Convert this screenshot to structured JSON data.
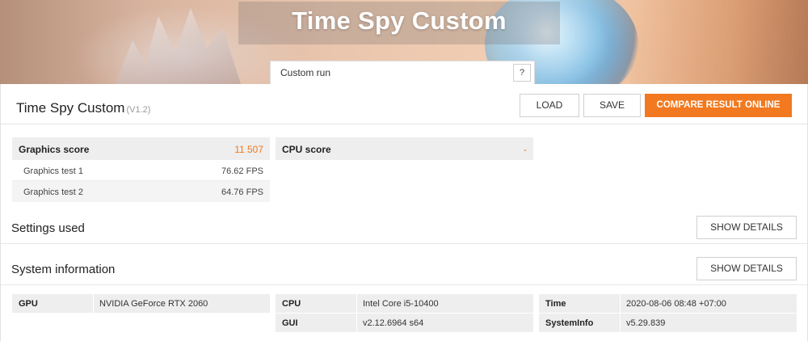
{
  "hero": {
    "title": "Time Spy Custom",
    "run_selector": {
      "value": "Custom run",
      "help_label": "?"
    }
  },
  "header": {
    "title": "Time Spy Custom",
    "version": "(V1.2)",
    "load_label": "LOAD",
    "save_label": "SAVE",
    "compare_label": "COMPARE RESULT ONLINE"
  },
  "graphics": {
    "label": "Graphics score",
    "value": "11 507",
    "tests": [
      {
        "name": "Graphics test 1",
        "value": "76.62 FPS"
      },
      {
        "name": "Graphics test 2",
        "value": "64.76 FPS"
      }
    ]
  },
  "cpu_score": {
    "label": "CPU score",
    "value": "-"
  },
  "settings": {
    "title": "Settings used",
    "details_label": "SHOW DETAILS"
  },
  "system": {
    "title": "System information",
    "details_label": "SHOW DETAILS",
    "rows": [
      {
        "key": "GPU",
        "value": "NVIDIA GeForce RTX 2060"
      },
      {
        "key": "CPU",
        "value": "Intel Core i5-10400"
      },
      {
        "key": "GUI",
        "value": "v2.12.6964 s64"
      },
      {
        "key": "Time",
        "value": "2020-08-06 08:48 +07:00"
      },
      {
        "key": "SystemInfo",
        "value": "v5.29.839"
      }
    ]
  },
  "colors": {
    "accent": "#f2791f",
    "row_bg": "#eeeeee"
  }
}
